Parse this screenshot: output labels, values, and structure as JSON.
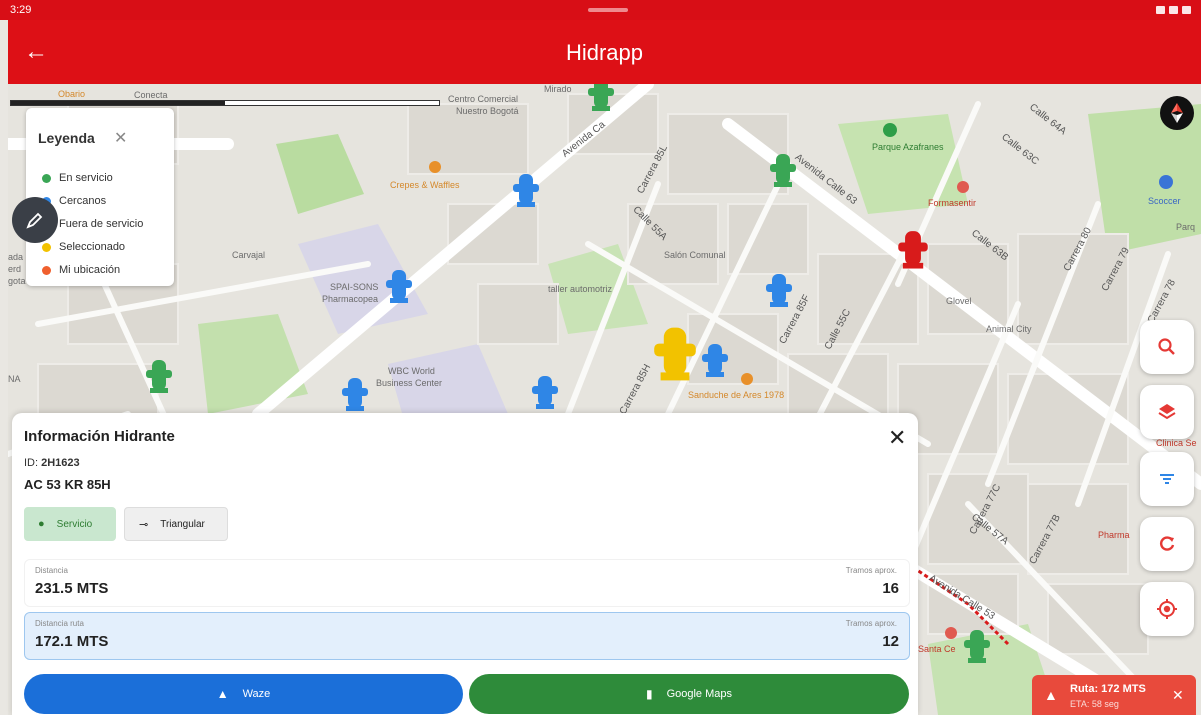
{
  "status": {
    "time": "3:29"
  },
  "appbar": {
    "title": "Hidrapp",
    "back_icon": "←"
  },
  "legend": {
    "title": "Leyenda",
    "close": "✕",
    "items": [
      {
        "label": "En servicio",
        "color": "#3aa655"
      },
      {
        "label": "Cercanos",
        "color": "#2f86e6"
      },
      {
        "label": "Fuera de servicio",
        "color": "#d81b1b"
      },
      {
        "label": "Seleccionado",
        "color": "#f2c200"
      },
      {
        "label": "Mi ubicación",
        "color": "#f0602e"
      }
    ]
  },
  "map_labels": {
    "obario": "Obario",
    "conecta": "Conecta",
    "centro_comercial": "Centro Comercial",
    "nuestro_bogota": "Nuestro Bogotá",
    "mirado": "Mirado",
    "avenida_cra": "Avenida Ca",
    "crepes": "Crepes & Waffles",
    "parque": "Parque Azafranes",
    "formasentir": "Formasentir",
    "scoccer": "Scoccer",
    "parq": "Parq",
    "carvajal": "Carvajal",
    "spai": "SPAI-SONS",
    "pharmacopea": "Pharmacopea",
    "taller": "taller automotriz",
    "salon": "Salón Comunal",
    "glovel": "Glovel",
    "animal": "Animal City",
    "wbc": "WBC World",
    "business": "Business Center",
    "sanduche": "Sanduche de Ares 1978",
    "clinica": "Clinica Se",
    "pharma": "Pharma",
    "santa": "Santa Ce",
    "ada": "ada",
    "erd": "erd",
    "gota": "gota",
    "na": "NA",
    "calle_64a": "Calle 64A",
    "calle_63c": "Calle 63C",
    "calle_63b": "Calle 63B",
    "carrera_80": "Carrera 80",
    "carrera_79": "Carrera 79",
    "carrera_78": "Carrera 78",
    "carrera_85l": "Carrera 85L",
    "calle_55a": "Calle 55A",
    "carrera_85f": "Carrera 85F",
    "calle_55c": "Calle 55C",
    "carrera_85h": "Carrera 85H",
    "avenida_calle_63": "Avenida Calle 63",
    "avenida_calle_53": "Avenida Calle 53",
    "avenida_cra_top": "Avenida Cra",
    "calle_57a": "Calle 57A",
    "calle_53": "Calle 53",
    "carrera_77c": "Carrera 77C",
    "carrera_77b": "Carrera 77B"
  },
  "panel": {
    "title": "Información Hidrante",
    "close": "✕",
    "id_label": "ID:",
    "id_value": "2H1623",
    "address": "AC 53 KR 85H",
    "chips": {
      "servicio": "Servicio",
      "triangular": "Triangular"
    },
    "distance_label": "Distancia",
    "distance_value": "231.5 MTS",
    "tramos_label": "Tramos aprox.",
    "tramos_value": "16",
    "route_distance_label": "Distancia ruta",
    "route_distance_value": "172.1 MTS",
    "route_tramos_label": "Tramos aprox.",
    "route_tramos_value": "12",
    "waze_label": "Waze",
    "gmaps_label": "Google Maps"
  },
  "route": {
    "title": "Ruta: 172 MTS",
    "eta": "ETA: 58 seg",
    "close": "✕"
  },
  "colors": {
    "accent": "#dd1016",
    "waze": "#1b6fd9",
    "gmaps": "#2e8b3a",
    "route": "#e84a3c"
  }
}
